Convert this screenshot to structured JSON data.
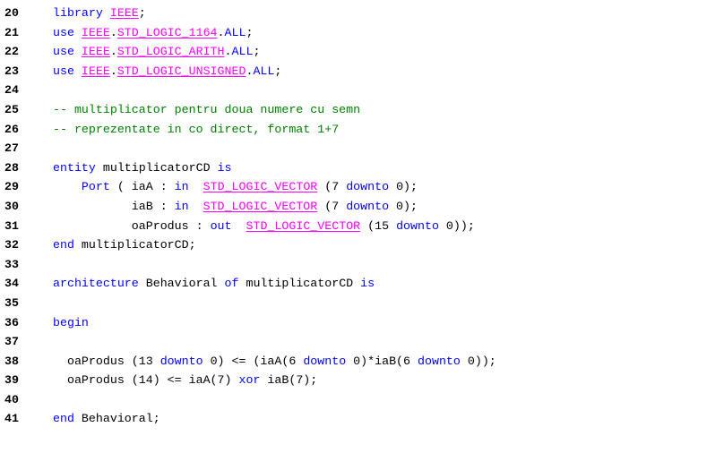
{
  "editor": {
    "colors": {
      "keyword": "#0000ff",
      "library": "#ff00ff",
      "comment": "#008000",
      "text": "#000000"
    },
    "lines": [
      {
        "num": "20",
        "tokens": [
          {
            "t": "kw",
            "v": "library "
          },
          {
            "t": "lib",
            "v": "IEEE"
          },
          {
            "t": "tx",
            "v": ";"
          }
        ]
      },
      {
        "num": "21",
        "tokens": [
          {
            "t": "kw",
            "v": "use "
          },
          {
            "t": "lib",
            "v": "IEEE"
          },
          {
            "t": "tx",
            "v": "."
          },
          {
            "t": "lib",
            "v": "STD_LOGIC_1164"
          },
          {
            "t": "tx",
            "v": "."
          },
          {
            "t": "kw",
            "v": "ALL"
          },
          {
            "t": "tx",
            "v": ";"
          }
        ]
      },
      {
        "num": "22",
        "tokens": [
          {
            "t": "kw",
            "v": "use "
          },
          {
            "t": "lib",
            "v": "IEEE"
          },
          {
            "t": "tx",
            "v": "."
          },
          {
            "t": "lib",
            "v": "STD_LOGIC_ARITH"
          },
          {
            "t": "tx",
            "v": "."
          },
          {
            "t": "kw",
            "v": "ALL"
          },
          {
            "t": "tx",
            "v": ";"
          }
        ]
      },
      {
        "num": "23",
        "tokens": [
          {
            "t": "kw",
            "v": "use "
          },
          {
            "t": "lib",
            "v": "IEEE"
          },
          {
            "t": "tx",
            "v": "."
          },
          {
            "t": "lib",
            "v": "STD_LOGIC_UNSIGNED"
          },
          {
            "t": "tx",
            "v": "."
          },
          {
            "t": "kw",
            "v": "ALL"
          },
          {
            "t": "tx",
            "v": ";"
          }
        ]
      },
      {
        "num": "24",
        "tokens": []
      },
      {
        "num": "25",
        "tokens": [
          {
            "t": "cm",
            "v": "-- multiplicator pentru doua numere cu semn"
          }
        ]
      },
      {
        "num": "26",
        "tokens": [
          {
            "t": "cm",
            "v": "-- reprezentate in co direct, format 1+7"
          }
        ]
      },
      {
        "num": "27",
        "tokens": []
      },
      {
        "num": "28",
        "tokens": [
          {
            "t": "kw",
            "v": "entity "
          },
          {
            "t": "tx",
            "v": "multiplicatorCD "
          },
          {
            "t": "kw",
            "v": "is"
          }
        ]
      },
      {
        "num": "29",
        "tokens": [
          {
            "t": "tx",
            "v": "    "
          },
          {
            "t": "kw",
            "v": "Port"
          },
          {
            "t": "tx",
            "v": " ( iaA : "
          },
          {
            "t": "kw",
            "v": "in"
          },
          {
            "t": "tx",
            "v": "  "
          },
          {
            "t": "lib",
            "v": "STD_LOGIC_VECTOR"
          },
          {
            "t": "tx",
            "v": " (7 "
          },
          {
            "t": "kw",
            "v": "downto"
          },
          {
            "t": "tx",
            "v": " 0);"
          }
        ]
      },
      {
        "num": "30",
        "tokens": [
          {
            "t": "tx",
            "v": "           iaB : "
          },
          {
            "t": "kw",
            "v": "in"
          },
          {
            "t": "tx",
            "v": "  "
          },
          {
            "t": "lib",
            "v": "STD_LOGIC_VECTOR"
          },
          {
            "t": "tx",
            "v": " (7 "
          },
          {
            "t": "kw",
            "v": "downto"
          },
          {
            "t": "tx",
            "v": " 0);"
          }
        ]
      },
      {
        "num": "31",
        "tokens": [
          {
            "t": "tx",
            "v": "           oaProdus : "
          },
          {
            "t": "kw",
            "v": "out"
          },
          {
            "t": "tx",
            "v": "  "
          },
          {
            "t": "lib",
            "v": "STD_LOGIC_VECTOR"
          },
          {
            "t": "tx",
            "v": " (15 "
          },
          {
            "t": "kw",
            "v": "downto"
          },
          {
            "t": "tx",
            "v": " 0));"
          }
        ]
      },
      {
        "num": "32",
        "tokens": [
          {
            "t": "kw",
            "v": "end "
          },
          {
            "t": "tx",
            "v": "multiplicatorCD;"
          }
        ]
      },
      {
        "num": "33",
        "tokens": []
      },
      {
        "num": "34",
        "tokens": [
          {
            "t": "kw",
            "v": "architecture "
          },
          {
            "t": "tx",
            "v": "Behavioral "
          },
          {
            "t": "kw",
            "v": "of "
          },
          {
            "t": "tx",
            "v": "multiplicatorCD "
          },
          {
            "t": "kw",
            "v": "is"
          }
        ]
      },
      {
        "num": "35",
        "tokens": []
      },
      {
        "num": "36",
        "tokens": [
          {
            "t": "kw",
            "v": "begin"
          }
        ]
      },
      {
        "num": "37",
        "tokens": []
      },
      {
        "num": "38",
        "tokens": [
          {
            "t": "tx",
            "v": "  oaProdus (13 "
          },
          {
            "t": "kw",
            "v": "downto"
          },
          {
            "t": "tx",
            "v": " 0) <= (iaA(6 "
          },
          {
            "t": "kw",
            "v": "downto"
          },
          {
            "t": "tx",
            "v": " 0)*iaB(6 "
          },
          {
            "t": "kw",
            "v": "downto"
          },
          {
            "t": "tx",
            "v": " 0));"
          }
        ]
      },
      {
        "num": "39",
        "tokens": [
          {
            "t": "tx",
            "v": "  oaProdus (14) <= iaA(7) "
          },
          {
            "t": "kw",
            "v": "xor"
          },
          {
            "t": "tx",
            "v": " iaB(7);"
          }
        ]
      },
      {
        "num": "40",
        "tokens": []
      },
      {
        "num": "41",
        "tokens": [
          {
            "t": "kw",
            "v": "end "
          },
          {
            "t": "tx",
            "v": "Behavioral;"
          }
        ]
      }
    ]
  }
}
